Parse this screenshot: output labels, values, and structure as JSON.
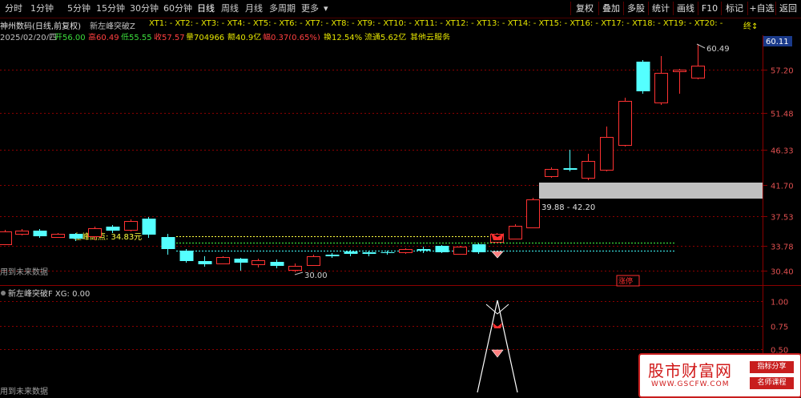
{
  "toolbar": {
    "periods": [
      "分时",
      "1分钟",
      "5分钟",
      "15分钟",
      "30分钟",
      "60分钟",
      "日线",
      "周线",
      "月线",
      "多周期",
      "更多"
    ],
    "active_period": "日线",
    "right_buttons": [
      "复权",
      "叠加",
      "多股",
      "统计",
      "画线",
      "F10",
      "标记",
      "+自选",
      "返回"
    ]
  },
  "info": {
    "stock_title": "神州数码(日线,前复权)",
    "indicator_name": "新左峰突破Z",
    "xt_list": "XT1: - XT2: - XT3: - XT4: - XT5: - XT6: - XT7: - XT8: - XT9: - XT10: - XT11: - XT12: - XT13: - XT14: - XT15: - XT16: - XT17: - XT18: - XT19: - XT20: -",
    "xt_more": "终↕",
    "date": "2025/02/20/四",
    "open": "开56.00",
    "high": "高60.49",
    "low": "低55.55",
    "close": "收57.57",
    "volume": "量704966",
    "amount": "额40.9亿",
    "change": "幅0.37(0.65%)",
    "turnover": "换12.54%",
    "float_cap": "流通5.62亿",
    "category": "其他云服务"
  },
  "main_chart": {
    "price_axis": [
      "57.20",
      "51.48",
      "46.33",
      "41.70",
      "37.53",
      "33.78",
      "30.40"
    ],
    "current_price": "60.11",
    "high_label": "60.49",
    "low_label": "30.00",
    "peak_label": "左峰高点:  34.83元",
    "zone_label": "39.88 - 42.20",
    "no_future_data": "用到未来数据",
    "limit_up_tag": "涨停"
  },
  "sub_chart": {
    "title": "新左峰突破F  XG: 0.00",
    "axis": [
      "1.00",
      "0.75",
      "0.50"
    ],
    "no_future_data": "用到未来数据"
  },
  "watermark": {
    "brand": "股市财富网",
    "url": "WWW.GSCFW.COM",
    "tag1": "指标分享",
    "tag2": "名师课程"
  },
  "colors": {
    "up": "#ff3232",
    "down": "#54ffff",
    "grid": "#8b0000",
    "yellow": "#ffff40",
    "zone": "#c0c0c0"
  }
}
